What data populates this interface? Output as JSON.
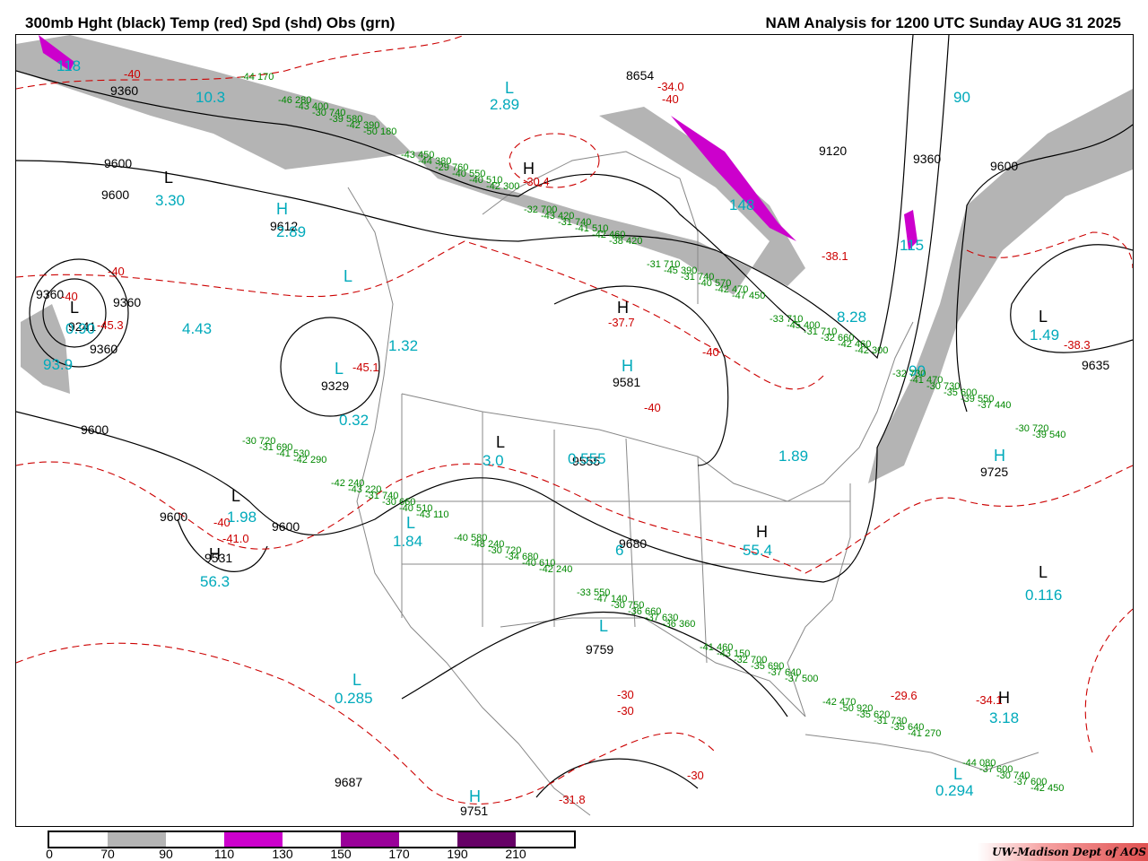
{
  "header": {
    "left_title": "300mb Hght (black) Temp (red) Spd (shd) Obs (grn)",
    "right_title": "NAM Analysis for 1200 UTC Sunday  AUG 31 2025"
  },
  "legend": {
    "ticks": [
      "0",
      "70",
      "90",
      "110",
      "130",
      "150",
      "170",
      "190",
      "210"
    ],
    "colors": [
      "#ffffff",
      "#b4b4b4",
      "#ffffff",
      "#cc00cc",
      "#ffffff",
      "#990099",
      "#ffffff",
      "#660066",
      "#ffffff"
    ]
  },
  "credit": "UW-Madison  Dept of AOS",
  "colors": {
    "height": "#000000",
    "temp": "#cc0000",
    "speed": "#00aabb",
    "obs": "#008800",
    "jet": "#b4b4b4",
    "jet_core": "#cc00cc"
  },
  "centers": [
    "H",
    "L",
    "L",
    "H",
    "L",
    "L",
    "H",
    "H",
    "L",
    "H",
    "L",
    "L",
    "H",
    "L",
    "H",
    "H",
    "L",
    "L",
    "H",
    "L",
    "L",
    "L"
  ],
  "heights": [
    "9360",
    "9600",
    "9600",
    "9612",
    "9360",
    "9241",
    "9360",
    "9329",
    "9581",
    "9360",
    "9600",
    "9120",
    "9600",
    "9600",
    "9531",
    "9600",
    "9759",
    "9687",
    "9751",
    "9635",
    "9725",
    "8654",
    "9360",
    "9680",
    "9555"
  ],
  "temps": [
    "-40",
    "-40",
    "-34.0",
    "-40",
    "-30.4",
    "-40",
    "-45.3",
    "-45.1",
    "-37.7",
    "-40",
    "-40",
    "-41.0",
    "-40",
    "-30",
    "-30",
    "-31.8",
    "-29.6",
    "-34.1",
    "-38.3",
    "-38.1",
    "-30"
  ],
  "speeds": [
    "118",
    "10.3",
    "2.89",
    "3.30",
    "2.89",
    "0.90",
    "4.43",
    "93.9",
    "1.32",
    "0.32",
    "3.0",
    "1.98",
    "56.3",
    "1.84",
    "0.555",
    "1.89",
    "6",
    "55.4",
    "8.28",
    "1.49",
    "0.116",
    "0.285",
    "0.294",
    "3.18",
    "90",
    "90",
    "115",
    "148"
  ],
  "obs": [
    "-44 170",
    "-50 180",
    "-42 300",
    "-38 420",
    "-47 450",
    "-42 300",
    "-37 440",
    "-42 290",
    "-43 110",
    "-42 240",
    "-36 360",
    "-37 500",
    "-41 270",
    "-42 450",
    "-42 390",
    "-40 510",
    "-42 460",
    "-42 470",
    "-42 460",
    "-39 550",
    "-41 530",
    "-40 510",
    "-40 610",
    "-37 630",
    "-37 640",
    "-35 640",
    "-37 600",
    "-39 580",
    "-40 550",
    "-41 510",
    "-40 570",
    "-32 660",
    "-35 600",
    "-31 690",
    "-30 660",
    "-34 680",
    "-36 660",
    "-35 690",
    "-31 730",
    "-30 740",
    "-30 740",
    "-29 760",
    "-31 740",
    "-31 740",
    "-31 710",
    "-30 730",
    "-30 720",
    "-31 740",
    "-30 720",
    "-30 750",
    "-32 700",
    "-35 620",
    "-37 600",
    "-43 400",
    "-44 380",
    "-43 420",
    "-45 390",
    "-45 400",
    "-41 470",
    "-39 540",
    "-43 220",
    "-48 240",
    "-47 140",
    "-43 150",
    "-50 920",
    "-44 080",
    "-46 280",
    "-43 450",
    "-32 700",
    "-31 710",
    "-33 710",
    "-32 730",
    "-30 720",
    "-42 240",
    "-40 580",
    "-33 550",
    "-41 460",
    "-42 470"
  ]
}
